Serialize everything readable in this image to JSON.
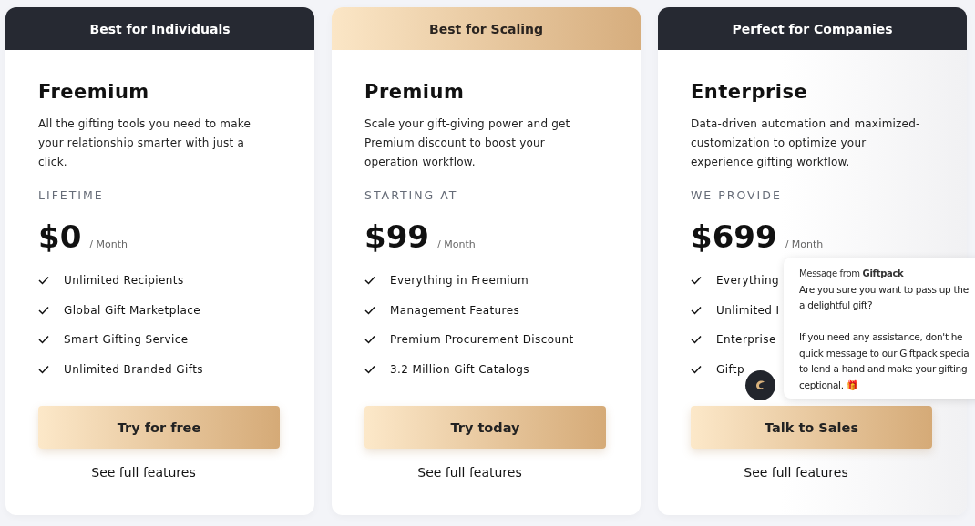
{
  "plans": [
    {
      "banner": "Best for Individuals",
      "highlighted": false,
      "name": "Freemium",
      "description": "All the gifting tools you need to make your relationship smarter with just a click.",
      "price_label": "LIFETIME",
      "price": "$0",
      "period": "/ Month",
      "features": [
        "Unlimited Recipients",
        "Global Gift Marketplace",
        "Smart Gifting Service",
        "Unlimited Branded Gifts"
      ],
      "cta": "Try for free",
      "link": "See full features"
    },
    {
      "banner": "Best for Scaling",
      "highlighted": true,
      "name": "Premium",
      "description": "Scale your gift-giving power and get Premium discount to boost your operation workflow.",
      "price_label": "STARTING AT",
      "price": "$99",
      "period": "/ Month",
      "features": [
        "Everything in Freemium",
        "Management Features",
        "Premium Procurement Discount",
        "3.2 Million Gift Catalogs"
      ],
      "cta": "Try today",
      "link": "See full features"
    },
    {
      "banner": "Perfect for Companies",
      "highlighted": false,
      "name": "Enterprise",
      "description": "Data-driven automation and maximized-customization to optimize your experience gifting workflow.",
      "price_label": "WE PROVIDE",
      "price": "$699",
      "period": "/ Month",
      "features": [
        "Everything",
        "Unlimited I",
        "Enterprise",
        "Giftp"
      ],
      "cta": "Talk to Sales",
      "link": "See full features"
    }
  ],
  "chat_popup": {
    "sender_prefix": "Message from",
    "sender": "Giftpack",
    "lines": [
      "Are you sure you want to pass up the",
      "a delightful gift?",
      "If you need any assistance, don't he",
      "quick message to our Giftpack specia",
      "to lend a hand and make your gifting",
      "ceptional. 🎁"
    ]
  }
}
